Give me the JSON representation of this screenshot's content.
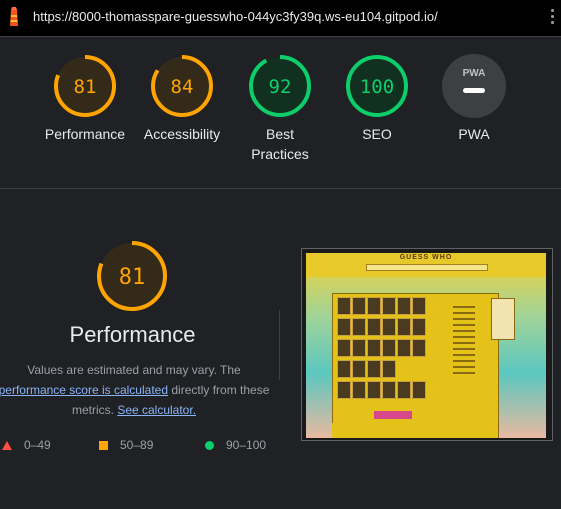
{
  "browser": {
    "url": "https://8000-thomasspare-guesswho-044yc3fy39q.ws-eu104.gitpod.io/"
  },
  "categories": [
    {
      "key": "performance",
      "score": 81,
      "label": "Performance",
      "color": "#ffa400"
    },
    {
      "key": "accessibility",
      "score": 84,
      "label": "Accessibility",
      "color": "#ffa400"
    },
    {
      "key": "best-practices",
      "score": 92,
      "label": "Best Practices",
      "color": "#0cce6b"
    },
    {
      "key": "seo",
      "score": 100,
      "label": "SEO",
      "color": "#0cce6b"
    },
    {
      "key": "pwa",
      "score": null,
      "label": "PWA",
      "color": "#9aa0a6"
    }
  ],
  "pwa_badge": "PWA",
  "performance_detail": {
    "score": 81,
    "title": "Performance",
    "desc_1": "Values are estimated and may vary. The",
    "desc_link_1": "performance score is calculated",
    "desc_2": "directly from these",
    "desc_3": "metrics.",
    "desc_link_2": "See calculator."
  },
  "legend": [
    {
      "range": "0–49",
      "shape": "triangle",
      "color": "#ff4e42"
    },
    {
      "range": "50–89",
      "shape": "square",
      "color": "#ffa400"
    },
    {
      "range": "90–100",
      "shape": "circle",
      "color": "#0cce6b"
    }
  ],
  "screenshot": {
    "title": "GUESS WHO"
  }
}
